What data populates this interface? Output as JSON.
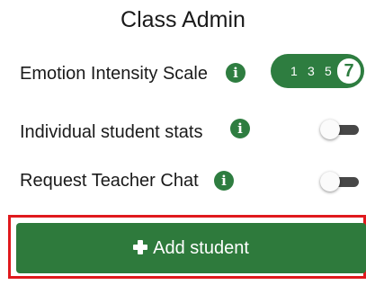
{
  "header": {
    "title": "Class Admin"
  },
  "settings": [
    {
      "label": "Emotion Intensity Scale",
      "info_icon": "info-icon"
    },
    {
      "label": "Individual student stats",
      "info_icon": "info-icon",
      "toggle_on": false
    },
    {
      "label": "Request Teacher Chat",
      "info_icon": "info-icon",
      "toggle_on": false
    }
  ],
  "scale_options": [
    "1",
    "3",
    "5",
    "7"
  ],
  "scale_selected": "7",
  "info_glyph": "i",
  "add_button": {
    "label": "Add student",
    "icon": "plus-icon"
  },
  "colors": {
    "accent": "#2e7d40",
    "highlight": "#e0191d"
  }
}
